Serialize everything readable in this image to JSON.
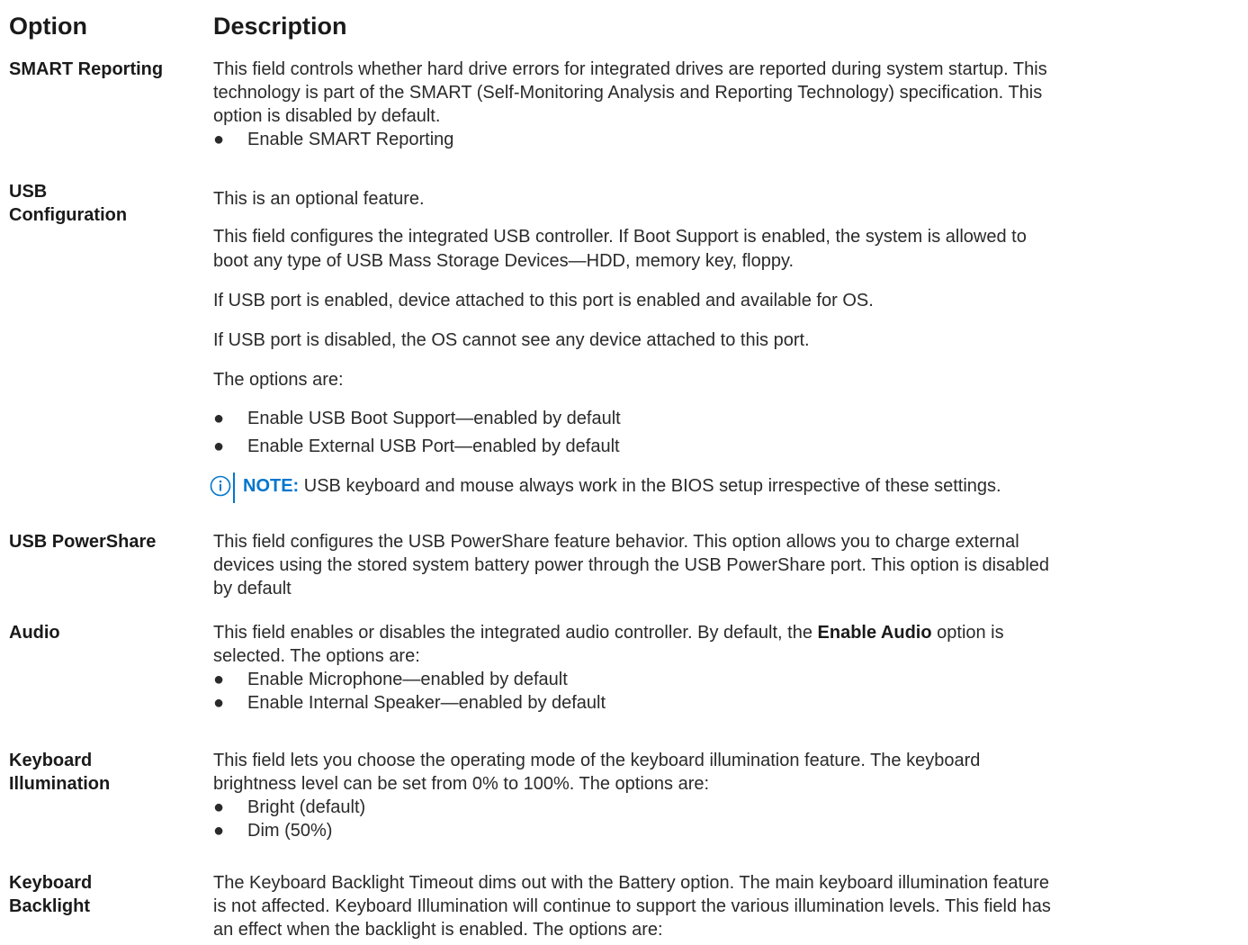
{
  "header": {
    "option": "Option",
    "description": "Description"
  },
  "rows": [
    {
      "option": "SMART Reporting",
      "lines": [
        "This field controls whether hard drive errors for integrated drives are reported during system startup. This",
        "technology is part of the SMART (Self-Monitoring Analysis and Reporting Technology) specification. This",
        "option is disabled by default."
      ],
      "bullets": [
        "Enable SMART Reporting"
      ]
    },
    {
      "option_lines": [
        "USB",
        "Configuration"
      ],
      "p1": "This is an optional feature.",
      "p2_lines": [
        "This field configures the integrated USB controller. If Boot Support is enabled, the system is allowed to",
        "boot any type of USB Mass Storage Devices—HDD, memory key, floppy."
      ],
      "p3": "If USB port is enabled, device attached to this port is enabled and available for OS.",
      "p4": "If USB port is disabled, the OS cannot see any device attached to this port.",
      "p5": "The options are:",
      "bullets": [
        "Enable USB Boot Support—enabled by default",
        "Enable External USB Port—enabled by default"
      ],
      "note_label": "NOTE:",
      "note_text": " USB keyboard and mouse always work in the BIOS setup irrespective of these settings."
    },
    {
      "option": "USB PowerShare",
      "lines": [
        "This field configures the USB PowerShare feature behavior. This option allows you to charge external",
        "devices using the stored system battery power through the USB PowerShare port. This option is disabled",
        "by default"
      ]
    },
    {
      "option": "Audio",
      "line1_pre": "This field enables or disables the integrated audio controller. By default, the ",
      "line1_bold": "Enable Audio",
      "line1_post": " option is",
      "line2": "selected. The options are:",
      "bullets": [
        "Enable Microphone—enabled by default",
        "Enable Internal Speaker—enabled by default"
      ]
    },
    {
      "option_lines": [
        "Keyboard",
        "Illumination"
      ],
      "lines": [
        "This field lets you choose the operating mode of the keyboard illumination feature. The keyboard",
        "brightness level can be set from 0% to 100%. The options are:"
      ],
      "bullets": [
        "Bright (default)",
        "Dim (50%)"
      ]
    },
    {
      "option_lines": [
        "Keyboard",
        "Backlight"
      ],
      "lines": [
        "The Keyboard Backlight Timeout dims out with the Battery option. The main keyboard illumination feature",
        "is not affected. Keyboard Illumination will continue to support the various illumination levels. This field has",
        "an effect when the backlight is enabled. The options are:"
      ]
    }
  ],
  "bullet_glyph": "●",
  "icons": {
    "note": "info-icon"
  },
  "colors": {
    "note_accent": "#0076ce",
    "text": "#2a2a2a"
  }
}
